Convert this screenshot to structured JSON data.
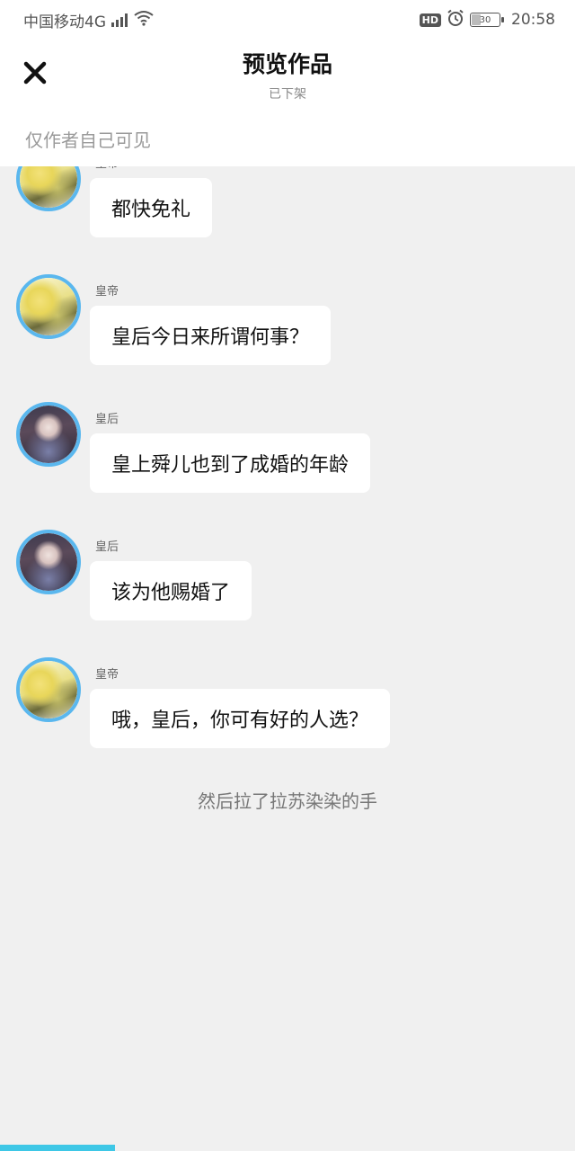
{
  "status_bar": {
    "carrier": "中国移动4G",
    "network": "4G",
    "hd_badge": "HD",
    "battery_level": "30",
    "time": "20:58",
    "icons": [
      "signal-icon",
      "wifi-icon",
      "alarm-icon",
      "battery-icon"
    ]
  },
  "header": {
    "title": "预览作品",
    "subtitle": "已下架",
    "close_icon": "close-icon",
    "visibility": "仅作者自己可见"
  },
  "messages": [
    {
      "speaker": "皇帝",
      "avatar": "emperor",
      "text": "都快免礼"
    },
    {
      "speaker": "皇帝",
      "avatar": "emperor",
      "text": "皇后今日来所谓何事？"
    },
    {
      "speaker": "皇后",
      "avatar": "empress",
      "text": "皇上舜儿也到了成婚的年龄"
    },
    {
      "speaker": "皇后",
      "avatar": "empress",
      "text": "该为他赐婚了"
    },
    {
      "speaker": "皇帝",
      "avatar": "emperor",
      "text": "哦，皇后，你可有好的人选？"
    }
  ],
  "narration": "然后拉了拉苏染染的手",
  "reading_progress": 0.2,
  "colors": {
    "accent": "#5ab7ee",
    "progress": "#3ec7e6",
    "background": "#f0f0f0"
  }
}
